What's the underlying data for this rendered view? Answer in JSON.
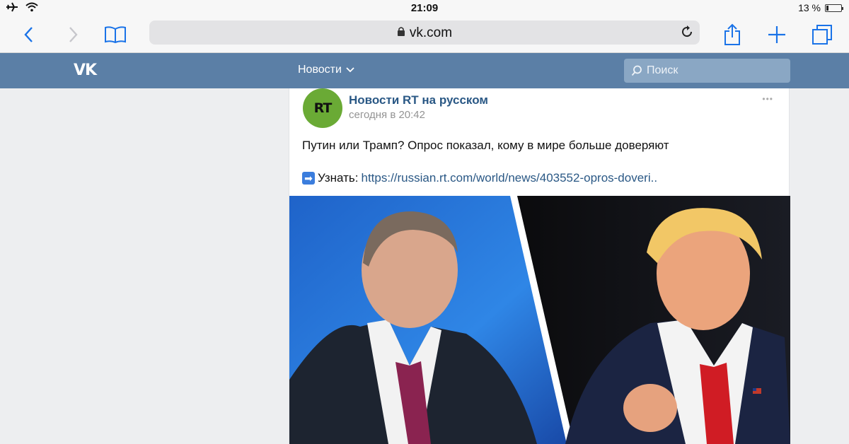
{
  "statusbar": {
    "time": "21:09",
    "battery_text": "13 %",
    "battery_level": 0.13,
    "airplane_icon": "airplane-icon",
    "wifi_icon": "wifi-icon"
  },
  "safari": {
    "address": "vk.com",
    "lock_icon": "lock-icon",
    "back_icon": "chevron-left-icon",
    "forward_icon": "chevron-right-icon",
    "bookmarks_icon": "book-icon",
    "reload_icon": "reload-icon",
    "share_icon": "share-icon",
    "new_tab_icon": "plus-icon",
    "tabs_icon": "tabs-icon",
    "accent": "#1a73e8"
  },
  "vk": {
    "logo": "VK",
    "menu_label": "Новости",
    "search_placeholder": "Поиск",
    "header_color": "#5b7fa6"
  },
  "post": {
    "author": "Новости RT на русском",
    "avatar_text": "RT",
    "date": "сегодня в 20:42",
    "more": "•••",
    "text": "Путин или Трамп? Опрос показал, кому в мире больше доверяют",
    "link_prefix": "Узнать:",
    "link": "https://russian.rt.com/world/news/403552-opros-doveri..",
    "arrow": "➡"
  }
}
